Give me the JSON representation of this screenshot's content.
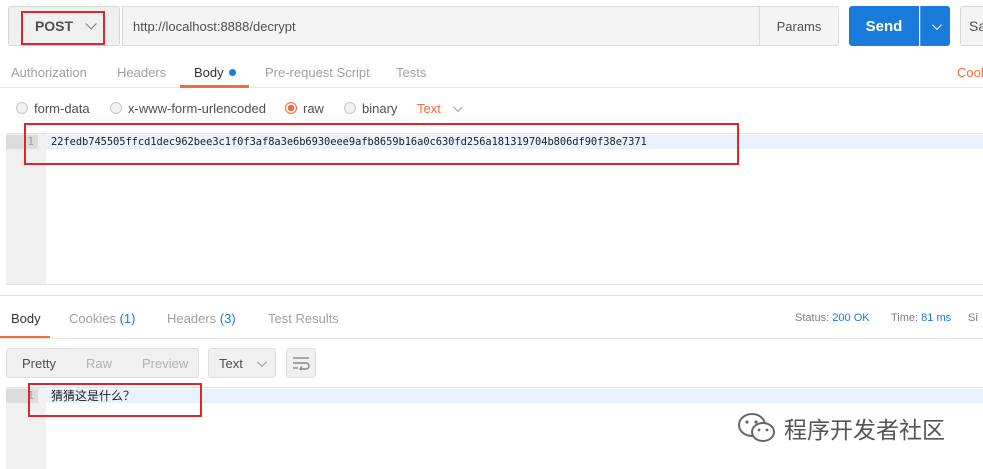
{
  "request": {
    "method": "POST",
    "url": "http://localhost:8888/decrypt",
    "params_label": "Params",
    "send_label": "Send",
    "save_label": "Sa"
  },
  "request_tabs": [
    {
      "label": "Authorization"
    },
    {
      "label": "Headers"
    },
    {
      "label": "Body",
      "active": true
    },
    {
      "label": "Pre-request Script"
    },
    {
      "label": "Tests"
    }
  ],
  "cookies_link": "Cook",
  "body_modes": [
    {
      "label": "form-data",
      "selected": false
    },
    {
      "label": "x-www-form-urlencoded",
      "selected": false
    },
    {
      "label": "raw",
      "selected": true
    },
    {
      "label": "binary",
      "selected": false
    }
  ],
  "raw_type": "Text",
  "request_body": {
    "line_number": "1",
    "content": "22fedb745505ffcd1dec962bee3c1f0f3af8a3e6b6930eee9afb8659b16a0c630fd256a181319704b806df90f38e7371"
  },
  "response_tabs": {
    "body": "Body",
    "cookies": "Cookies",
    "cookies_count": "(1)",
    "headers": "Headers",
    "headers_count": "(3)",
    "test_results": "Test Results"
  },
  "response_status": {
    "status_label": "Status:",
    "status_value": "200 OK",
    "time_label": "Time:",
    "time_value": "81 ms",
    "size_label": "Si"
  },
  "view_modes": [
    "Pretty",
    "Raw",
    "Preview"
  ],
  "response_format": "Text",
  "response_body": {
    "line_number": "1",
    "content": "猜猜这是什么？"
  },
  "watermark": "程序开发者社区",
  "colors": {
    "accent": "#f26b3a",
    "send_blue": "#1a7bdb",
    "highlight_red": "#e0242b"
  }
}
